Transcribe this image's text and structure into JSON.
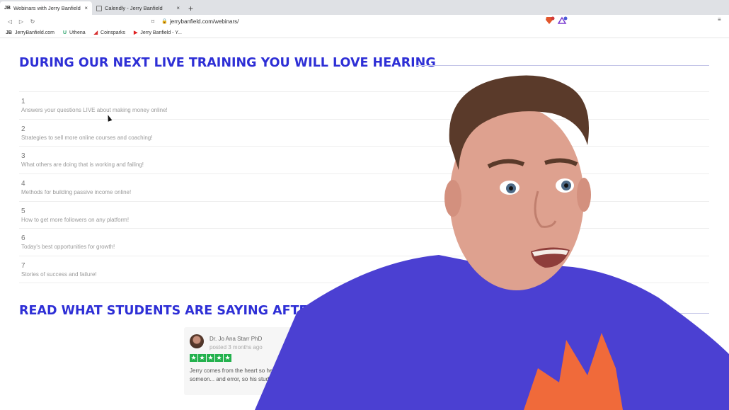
{
  "browser": {
    "tabs": [
      {
        "favicon": "JB",
        "title": "Webinars with Jerry Banfield - J",
        "active": true
      },
      {
        "favicon": "",
        "title": "Calendly - Jerry Banfield",
        "active": false
      }
    ],
    "close_glyph": "×",
    "new_tab_glyph": "+",
    "url": "jerrybanfield.com/webinars/",
    "back_glyph": "◁",
    "forward_glyph": "▷",
    "reload_glyph": "↻",
    "bookmark_glyph": "⌑",
    "lock_glyph": "🔒",
    "menu_glyph": "≡",
    "bookmarks": [
      {
        "icon": "JB",
        "label": "JerryBanfield.com",
        "color": "#222222"
      },
      {
        "icon": "U",
        "label": "Uthena",
        "color": "#2aa36b"
      },
      {
        "icon": "◢",
        "label": "Coinsparks",
        "color": "#d62e2e"
      },
      {
        "icon": "▶",
        "label": "Jerry Banfield - Y...",
        "color": "#e02020"
      }
    ]
  },
  "page": {
    "heading1": "DURING OUR NEXT LIVE TRAINING YOU WILL LOVE HEARING",
    "items": [
      {
        "num": "1",
        "text": "Answers your questions LIVE about making money online!"
      },
      {
        "num": "2",
        "text": "Strategies to sell more online courses and coaching!"
      },
      {
        "num": "3",
        "text": "What others are doing that is working and failing!"
      },
      {
        "num": "4",
        "text": "Methods for building passive income online!"
      },
      {
        "num": "5",
        "text": "How to get more followers on any platform!"
      },
      {
        "num": "6",
        "text": "Today's best opportunities for growth!"
      },
      {
        "num": "7",
        "text": "Stories of success and failure!"
      }
    ],
    "heading2": "READ WHAT STUDENTS ARE SAYING AFTER BUYING M",
    "review": {
      "name": "Dr. Jo Ana Starr PhD",
      "date": "posted 3 months ago",
      "stars": 5,
      "star_glyph": "★",
      "text": "Jerry comes from the heart so he is in... course is NOT a rehash of someon... and error, so his students are a..."
    }
  },
  "colors": {
    "heading": "#2e2fd6",
    "star": "#23b14d",
    "shirt": "#4a3fd0"
  }
}
